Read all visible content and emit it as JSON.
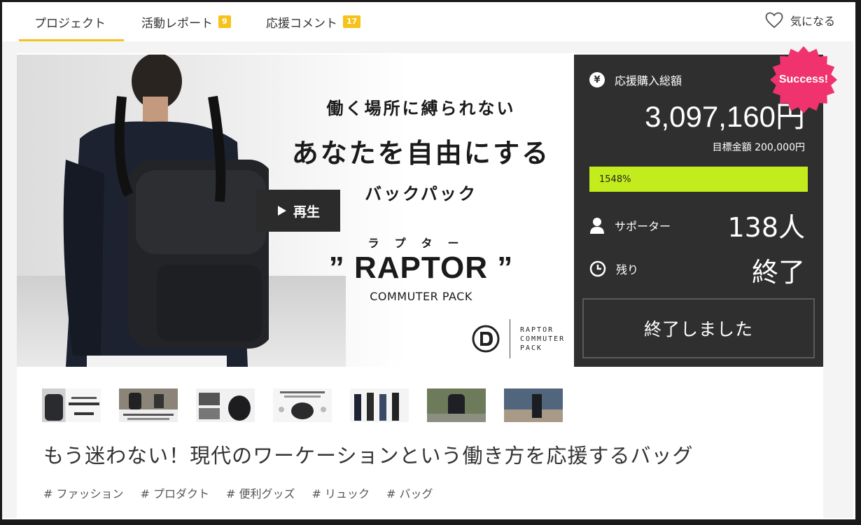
{
  "nav": {
    "tabs": [
      {
        "label": "プロジェクト",
        "badge": ""
      },
      {
        "label": "活動レポート",
        "badge": "9"
      },
      {
        "label": "応援コメント",
        "badge": "17"
      }
    ],
    "favorite_label": "気になる"
  },
  "hero": {
    "line1": "働く場所に縛られない",
    "line2": "あなたを自由にする",
    "line3": "バックパック",
    "ruby": "ラプター",
    "product_name": "” RAPTOR ”",
    "product_sub": "COMMUTER PACK",
    "play_label": "再生",
    "brand_text": [
      "RAPTOR",
      "COMMUTER",
      "PACK"
    ]
  },
  "funding": {
    "total_label": "応援購入総額",
    "total_value": "3,097,160円",
    "goal_label": "目標金額 200,000円",
    "progress_text": "1548%",
    "progress_percent": 100,
    "supporters_label": "サポーター",
    "supporters_value": "138人",
    "remaining_label": "残り",
    "remaining_value": "終了",
    "ended_button": "終了しました",
    "success_badge": "Success!",
    "accent_color": "#c2ec1b",
    "badge_color": "#f0336f"
  },
  "project_title": "もう迷わない！現代のワーケーションという働き方を応援するバッグ",
  "tags": [
    "# ファッション",
    "# プロダクト",
    "# 便利グッズ",
    "# リュック",
    "# バッグ"
  ]
}
